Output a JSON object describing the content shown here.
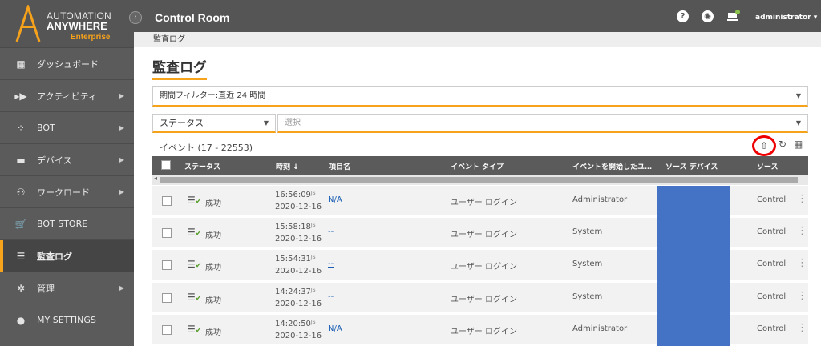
{
  "brand": {
    "line1": "AUTOMATION",
    "line2": "ANYWHERE",
    "line3": "Enterprise"
  },
  "sidebar": {
    "items": [
      {
        "label": "ダッシュボード",
        "icon": "dashboard-icon"
      },
      {
        "label": "アクティビティ",
        "icon": "activity-icon"
      },
      {
        "label": "BOT",
        "icon": "bot-icon"
      },
      {
        "label": "デバイス",
        "icon": "device-icon"
      },
      {
        "label": "ワークロード",
        "icon": "workload-icon"
      },
      {
        "label": "BOT STORE",
        "icon": "store-icon"
      },
      {
        "label": "監査ログ",
        "icon": "list-icon",
        "active": true
      },
      {
        "label": "管理",
        "icon": "gear-icon"
      },
      {
        "label": "MY SETTINGS",
        "icon": "user-icon"
      }
    ]
  },
  "topbar": {
    "title": "Control Room",
    "user": "administrator"
  },
  "breadcrumb": "監査ログ",
  "page_title": "監査ログ",
  "filter": {
    "period": "期間フィルター:直近 24 時間",
    "status": "ステータス",
    "select_placeholder": "選択"
  },
  "events_label": "イベント (17 - 22553)",
  "table": {
    "headers": [
      "ステータス",
      "時刻",
      "項目名",
      "イベント タイプ",
      "イベントを開始したユ…",
      "ソース デバイス",
      "ソース"
    ],
    "sort_indicator": "↓",
    "zone": "JST",
    "rows": [
      {
        "status": "成功",
        "time": "16:56:09",
        "date": "2020-12-16",
        "item": "N/A",
        "event": "ユーザー ログイン",
        "user": "Administrator",
        "source": "Control Ro"
      },
      {
        "status": "成功",
        "time": "15:58:18",
        "date": "2020-12-16",
        "item": "--",
        "event": "ユーザー ログイン",
        "user": "System",
        "source": "Control Ro"
      },
      {
        "status": "成功",
        "time": "15:54:31",
        "date": "2020-12-16",
        "item": "--",
        "event": "ユーザー ログイン",
        "user": "System",
        "source": "Control Ro"
      },
      {
        "status": "成功",
        "time": "14:24:37",
        "date": "2020-12-16",
        "item": "--",
        "event": "ユーザー ログイン",
        "user": "System",
        "source": "Control Ro"
      },
      {
        "status": "成功",
        "time": "14:20:50",
        "date": "2020-12-16",
        "item": "N/A",
        "event": "ユーザー ログイン",
        "user": "Administrator",
        "source": "Control Ro"
      }
    ]
  },
  "colors": {
    "accent": "#f7a21b",
    "sidebar": "#5b5b5b",
    "redaction": "#4472c4"
  }
}
